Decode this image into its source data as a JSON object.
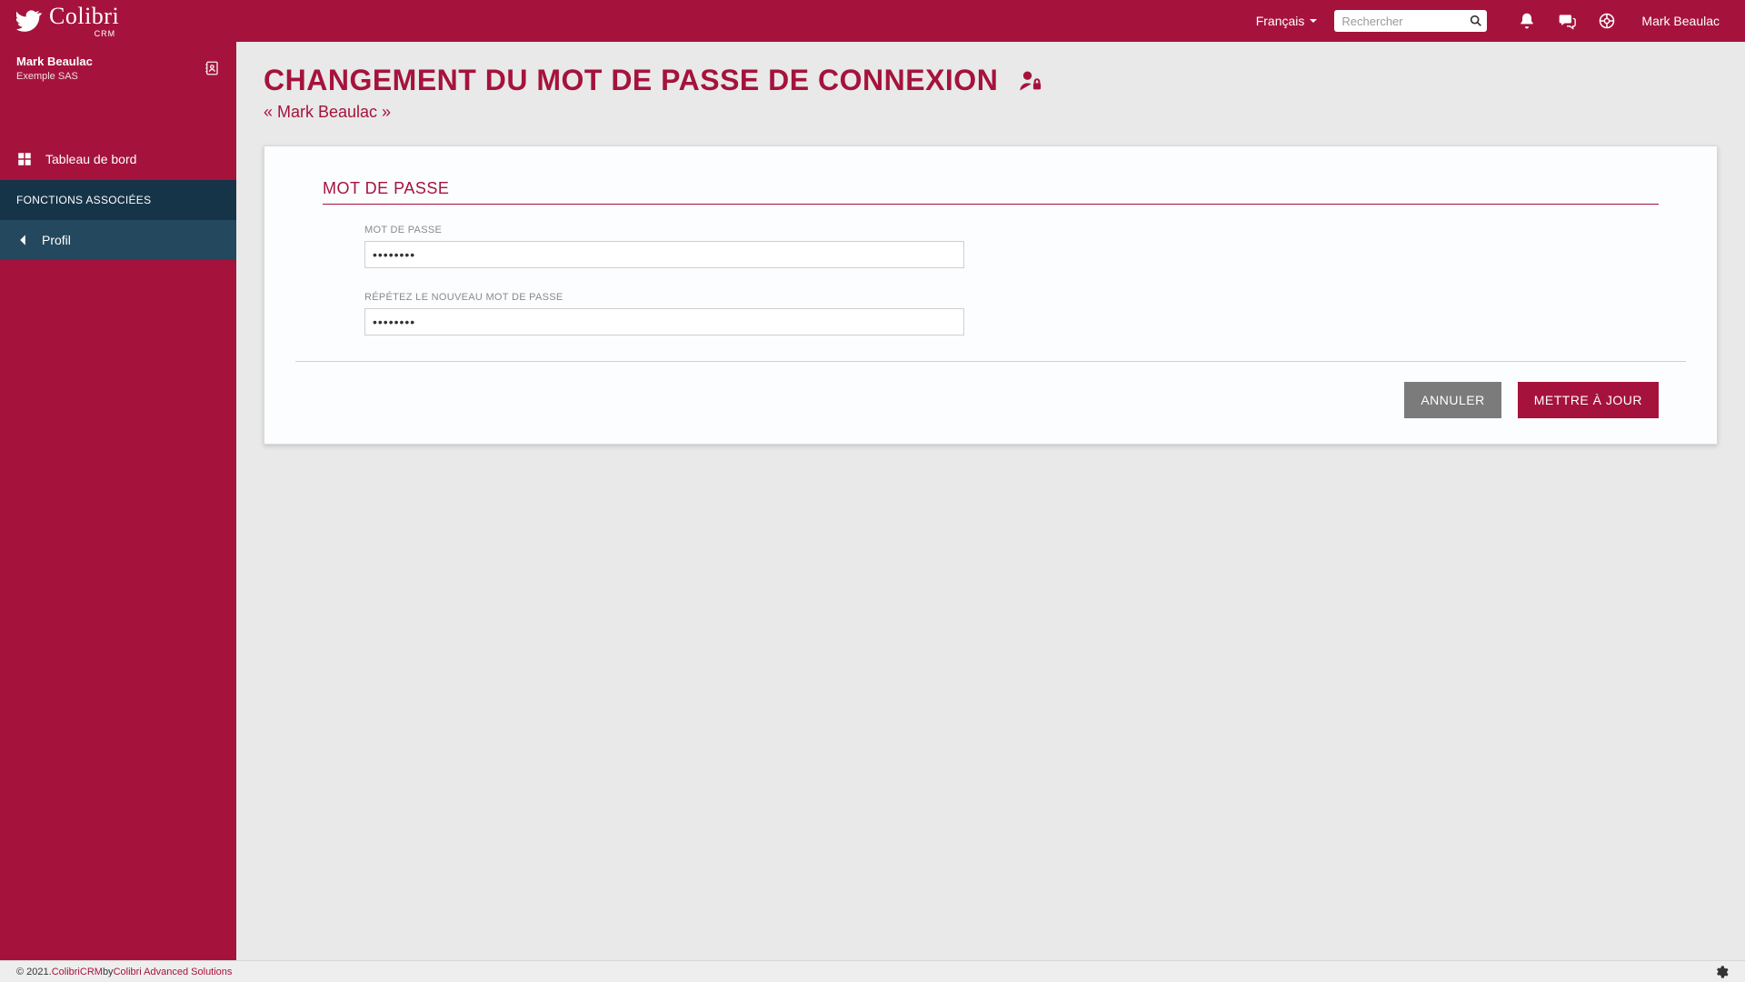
{
  "brand": {
    "name": "Colibri",
    "sub": "CRM"
  },
  "topbar": {
    "language": "Français",
    "search_placeholder": "Rechercher",
    "user_name": "Mark Beaulac"
  },
  "sidebar": {
    "user_name": "Mark Beaulac",
    "org_name": "Exemple SAS",
    "dashboard_label": "Tableau de bord",
    "section_header": "FONCTIONS ASSOCIÉES",
    "profile_label": "Profil"
  },
  "page": {
    "title": "CHANGEMENT DU MOT DE PASSE DE CONNEXION",
    "subtitle": "« Mark Beaulac »"
  },
  "form": {
    "section_title": "MOT DE PASSE",
    "password_label": "MOT DE PASSE",
    "password_value": "••••••••",
    "repeat_label": "RÉPÉTEZ LE NOUVEAU MOT DE PASSE",
    "repeat_value": "••••••••",
    "cancel_label": "ANNULER",
    "submit_label": "METTRE À JOUR"
  },
  "footer": {
    "copyright_prefix": "© 2021. ",
    "product": "ColibriCRM",
    "by": " by ",
    "company": "Colibri Advanced Solutions"
  }
}
